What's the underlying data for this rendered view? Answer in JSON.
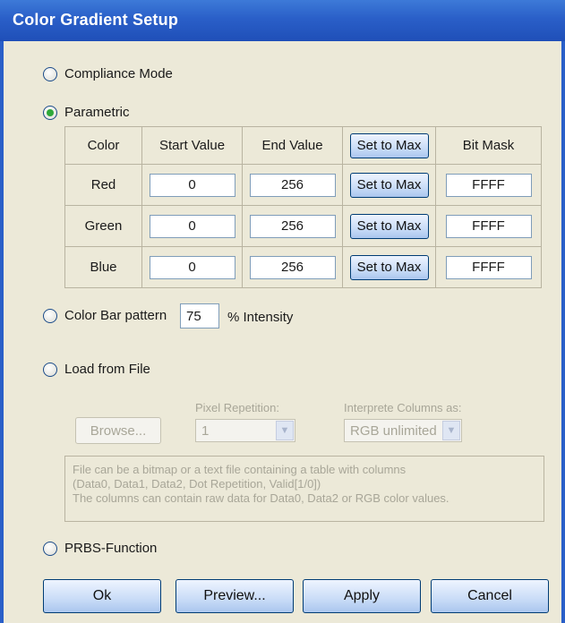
{
  "window": {
    "title": "Color Gradient Setup"
  },
  "modes": {
    "compliance": "Compliance Mode",
    "parametric": "Parametric",
    "color_bar": "Color Bar pattern",
    "load_file": "Load from File",
    "prbs": "PRBS-Function",
    "selected": "parametric"
  },
  "table": {
    "headers": [
      "Color",
      "Start Value",
      "End Value",
      "Set to Max",
      "Bit Mask"
    ],
    "rows": [
      {
        "color": "Red",
        "start": "0",
        "end": "256",
        "button": "Set to Max",
        "mask": "FFFF"
      },
      {
        "color": "Green",
        "start": "0",
        "end": "256",
        "button": "Set to Max",
        "mask": "FFFF"
      },
      {
        "color": "Blue",
        "start": "0",
        "end": "256",
        "button": "Set to Max",
        "mask": "FFFF"
      }
    ]
  },
  "color_bar": {
    "intensity": "75",
    "suffix": "% Intensity"
  },
  "load_file": {
    "browse_label": "Browse...",
    "pixel_repetition_label": "Pixel Repetition:",
    "pixel_repetition_value": "1",
    "interprete_label": "Interprete Columns as:",
    "interprete_value": "RGB unlimited",
    "info_lines": [
      "File can be a bitmap or a text file containing a table with columns",
      "(Data0, Data1, Data2, Dot Repetition, Valid[1/0])",
      "The columns can contain raw data for Data0, Data2 or RGB color values."
    ]
  },
  "buttons": {
    "ok": "Ok",
    "preview": "Preview...",
    "apply": "Apply",
    "cancel": "Cancel"
  }
}
